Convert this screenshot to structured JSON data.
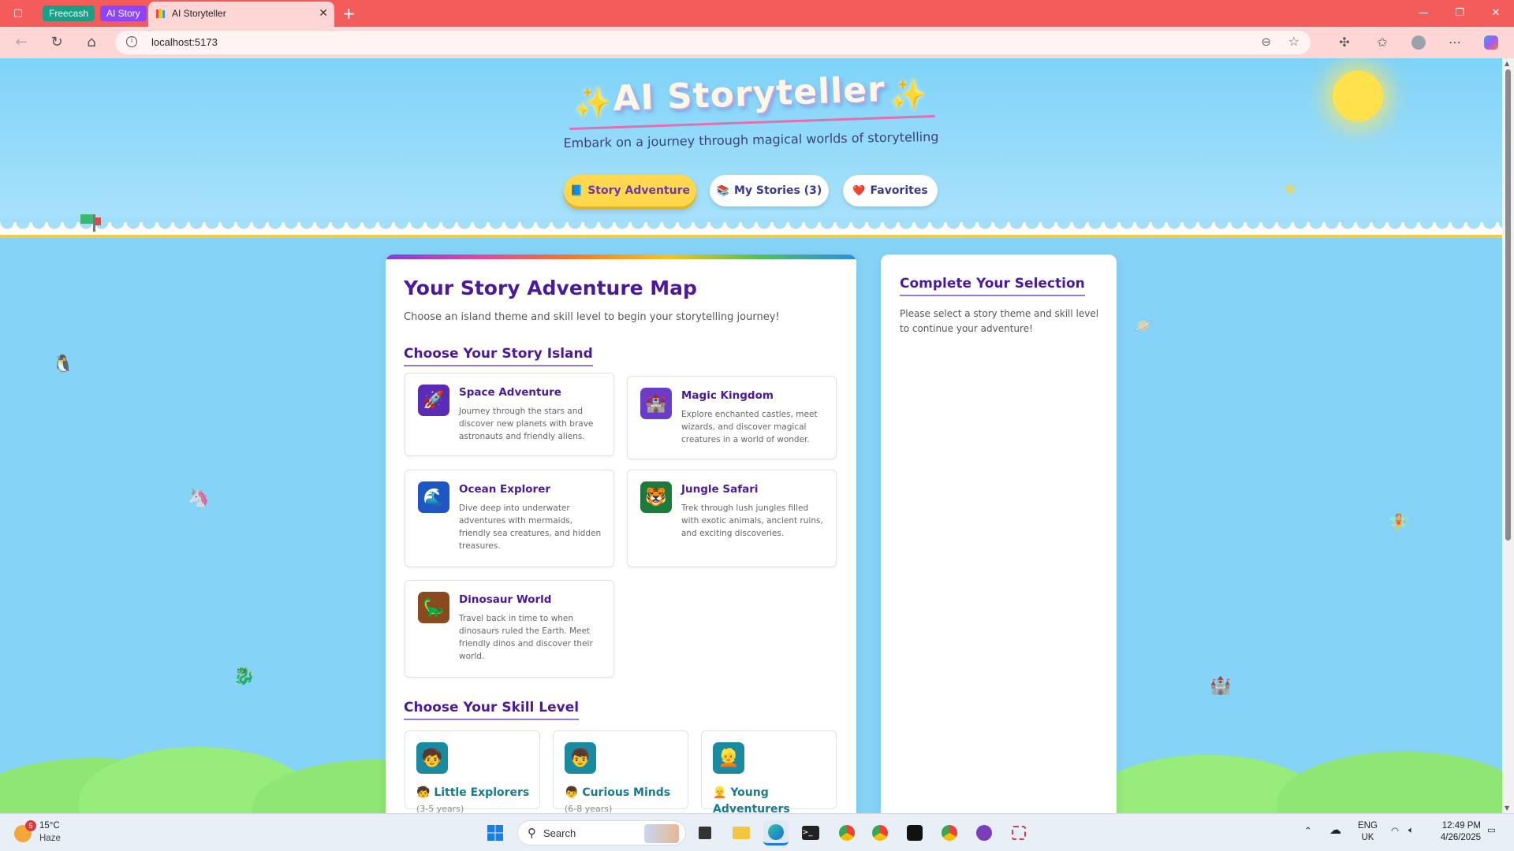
{
  "browser": {
    "pinned_tabs": [
      {
        "label": "Freecash",
        "color": "#16a085"
      },
      {
        "label": "AI Story",
        "color": "#8e44ff"
      }
    ],
    "active_tab": {
      "title": "AI Storyteller",
      "favicon": "books-icon"
    },
    "url": "localhost:5173"
  },
  "header": {
    "title": "AI Storyteller",
    "subtitle": "Embark on a journey through magical worlds of storytelling",
    "nav": [
      {
        "label": "Story Adventure",
        "icon": "📘",
        "active": true
      },
      {
        "label": "My Stories (3)",
        "icon": "📚",
        "active": false
      },
      {
        "label": "Favorites",
        "icon": "❤️",
        "active": false
      }
    ]
  },
  "main": {
    "title": "Your Story Adventure Map",
    "intro": "Choose an island theme and skill level to begin your storytelling journey!",
    "islands_heading": "Choose Your Story Island",
    "islands": [
      {
        "name": "Space Adventure",
        "icon": "🚀",
        "color": "#5b2bb5",
        "description": "Journey through the stars and discover new planets with brave astronauts and friendly aliens."
      },
      {
        "name": "Magic Kingdom",
        "icon": "🏰",
        "color": "#6a3cc7",
        "description": "Explore enchanted castles, meet wizards, and discover magical creatures in a world of wonder."
      },
      {
        "name": "Ocean Explorer",
        "icon": "🌊",
        "color": "#1f56c4",
        "description": "Dive deep into underwater adventures with mermaids, friendly sea creatures, and hidden treasures."
      },
      {
        "name": "Jungle Safari",
        "icon": "🐯",
        "color": "#1c7a3a",
        "description": "Trek through lush jungles filled with exotic animals, ancient ruins, and exciting discoveries."
      },
      {
        "name": "Dinosaur World",
        "icon": "🦕",
        "color": "#8a4a1e",
        "description": "Travel back in time to when dinosaurs ruled the Earth. Meet friendly dinos and discover their world."
      }
    ],
    "skills_heading": "Choose Your Skill Level",
    "skills": [
      {
        "name": "Little Explorers",
        "icon": "🧒",
        "prefix": "🧒",
        "age": "(3-5 years)"
      },
      {
        "name": "Curious Minds",
        "icon": "👦",
        "prefix": "👦",
        "age": "(6-8 years)"
      },
      {
        "name": "Young Adventurers",
        "icon": "👱",
        "prefix": "👱",
        "age": ""
      }
    ]
  },
  "sidebar": {
    "title": "Complete Your Selection",
    "text": "Please select a story theme and skill level to continue your adventure!"
  },
  "taskbar": {
    "weather_temp": "15°C",
    "weather_desc": "Haze",
    "weather_badge": "5",
    "search_label": "Search",
    "lang_top": "ENG",
    "lang_bottom": "UK",
    "time": "12:49 PM",
    "date": "4/26/2025"
  }
}
